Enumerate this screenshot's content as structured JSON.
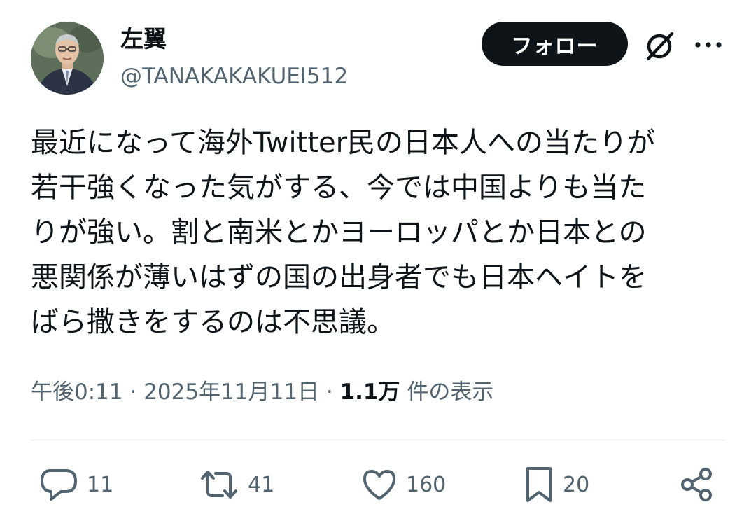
{
  "author": {
    "display_name": "左翼",
    "handle": "@TANAKAKAKUEI512"
  },
  "header": {
    "follow_label": "フォロー",
    "grok_icon": "grok-icon",
    "more_icon": "more-icon"
  },
  "tweet": {
    "text": "最近になって海外Twitter民の日本人への当たりが\n若干強くなった気がする、今では中国よりも当た\nりが強い。割と南米とかヨーロッパとか日本との\n悪関係が薄いはずの国の出身者でも日本ヘイトを\nばら撒きをするのは不思議。"
  },
  "meta": {
    "time": "午後0:11",
    "separator": "·",
    "date": "2025年11月11日",
    "views_count": "1.1万",
    "views_label": "件の表示"
  },
  "actions": {
    "replies": "11",
    "reposts": "41",
    "likes": "160",
    "bookmarks": "20"
  },
  "colors": {
    "text": "#0f1419",
    "secondary": "#536471",
    "divider": "#e1e6ea",
    "button_bg": "#0f1419"
  }
}
